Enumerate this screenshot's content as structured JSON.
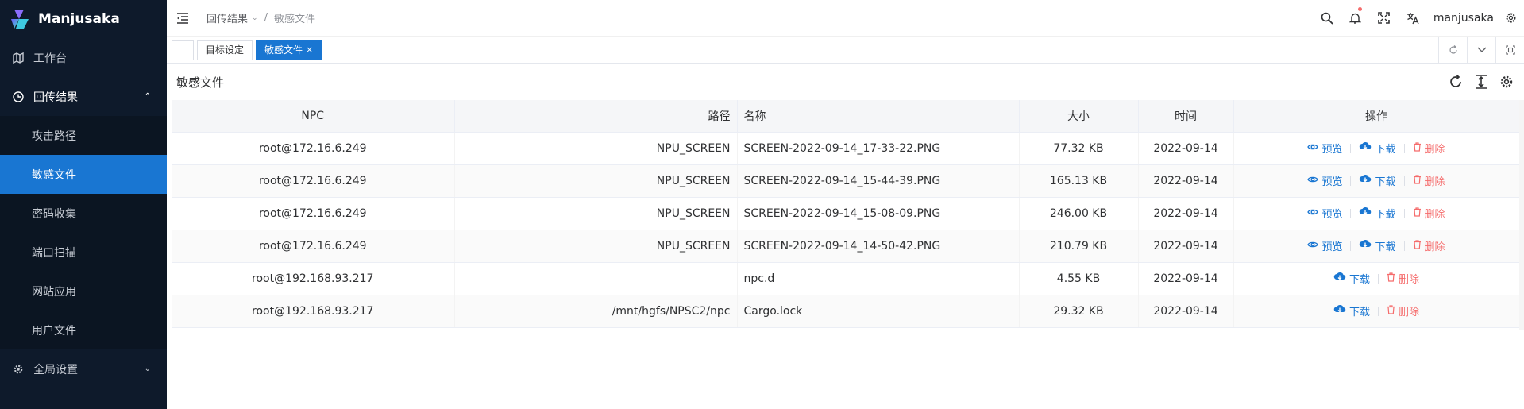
{
  "app": {
    "name": "Manjusaka"
  },
  "sidebar": {
    "items": [
      {
        "label": "工作台",
        "icon": "map-icon"
      },
      {
        "label": "回传结果",
        "icon": "clock-icon",
        "expanded": true,
        "children": [
          {
            "label": "攻击路径"
          },
          {
            "label": "敏感文件",
            "active": true
          },
          {
            "label": "密码收集"
          },
          {
            "label": "端口扫描"
          },
          {
            "label": "网站应用"
          },
          {
            "label": "用户文件"
          }
        ]
      },
      {
        "label": "全局设置",
        "icon": "gear-icon"
      }
    ]
  },
  "header": {
    "breadcrumb": [
      "回传结果",
      "敏感文件"
    ],
    "breadcrumb_sep": "/",
    "username": "manjusaka"
  },
  "tabs": [
    {
      "label": "目标设定",
      "active": false
    },
    {
      "label": "敏感文件",
      "active": true,
      "close": "×"
    }
  ],
  "content": {
    "title": "敏感文件"
  },
  "table": {
    "columns": [
      "NPC",
      "路径",
      "名称",
      "大小",
      "时间",
      "操作"
    ],
    "rows": [
      {
        "npc": "root@172.16.6.249",
        "path": "NPU_SCREEN",
        "name": "SCREEN-2022-09-14_17-33-22.PNG",
        "size": "77.32 KB",
        "time": "2022-09-14",
        "preview": true
      },
      {
        "npc": "root@172.16.6.249",
        "path": "NPU_SCREEN",
        "name": "SCREEN-2022-09-14_15-44-39.PNG",
        "size": "165.13 KB",
        "time": "2022-09-14",
        "preview": true
      },
      {
        "npc": "root@172.16.6.249",
        "path": "NPU_SCREEN",
        "name": "SCREEN-2022-09-14_15-08-09.PNG",
        "size": "246.00 KB",
        "time": "2022-09-14",
        "preview": true
      },
      {
        "npc": "root@172.16.6.249",
        "path": "NPU_SCREEN",
        "name": "SCREEN-2022-09-14_14-50-42.PNG",
        "size": "210.79 KB",
        "time": "2022-09-14",
        "preview": true
      },
      {
        "npc": "root@192.168.93.217",
        "path": "",
        "name": "npc.d",
        "size": "4.55 KB",
        "time": "2022-09-14",
        "preview": false
      },
      {
        "npc": "root@192.168.93.217",
        "path": "/mnt/hgfs/NPSC2/npc",
        "name": "Cargo.lock",
        "size": "29.32 KB",
        "time": "2022-09-14",
        "preview": false
      }
    ],
    "actions": {
      "preview": "预览",
      "download": "下载",
      "delete": "删除"
    }
  },
  "colors": {
    "sidebar_bg": "#0e1a2b",
    "accent": "#1976d2",
    "danger": "#f56c6c"
  }
}
